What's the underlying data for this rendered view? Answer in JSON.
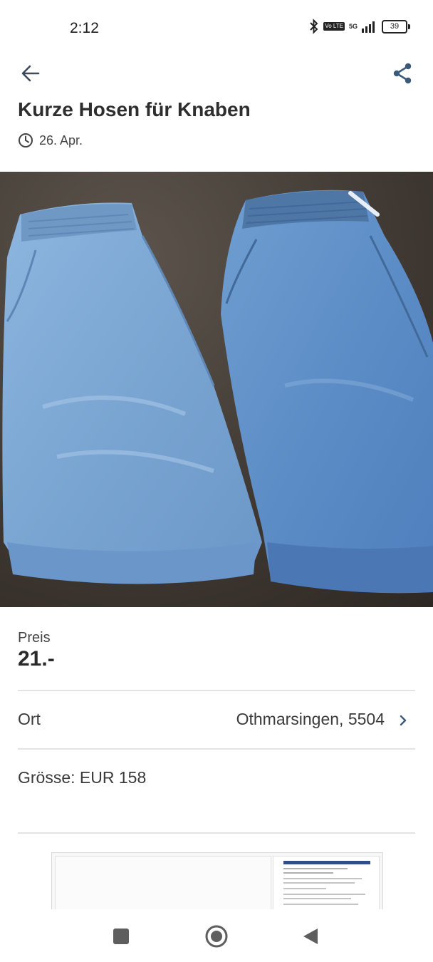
{
  "status_bar": {
    "time": "2:12",
    "network": "5G",
    "volte": "Vo LTE",
    "battery": "39"
  },
  "listing": {
    "title": "Kurze Hosen für Knaben",
    "date": "26. Apr."
  },
  "details": {
    "price_label": "Preis",
    "price_value": "21.-",
    "location_label": "Ort",
    "location_value": "Othmarsingen, 5504",
    "size_text": "Grösse: EUR 158"
  },
  "colors": {
    "accent": "#3b5a7a",
    "divider": "#e3e3e3"
  }
}
